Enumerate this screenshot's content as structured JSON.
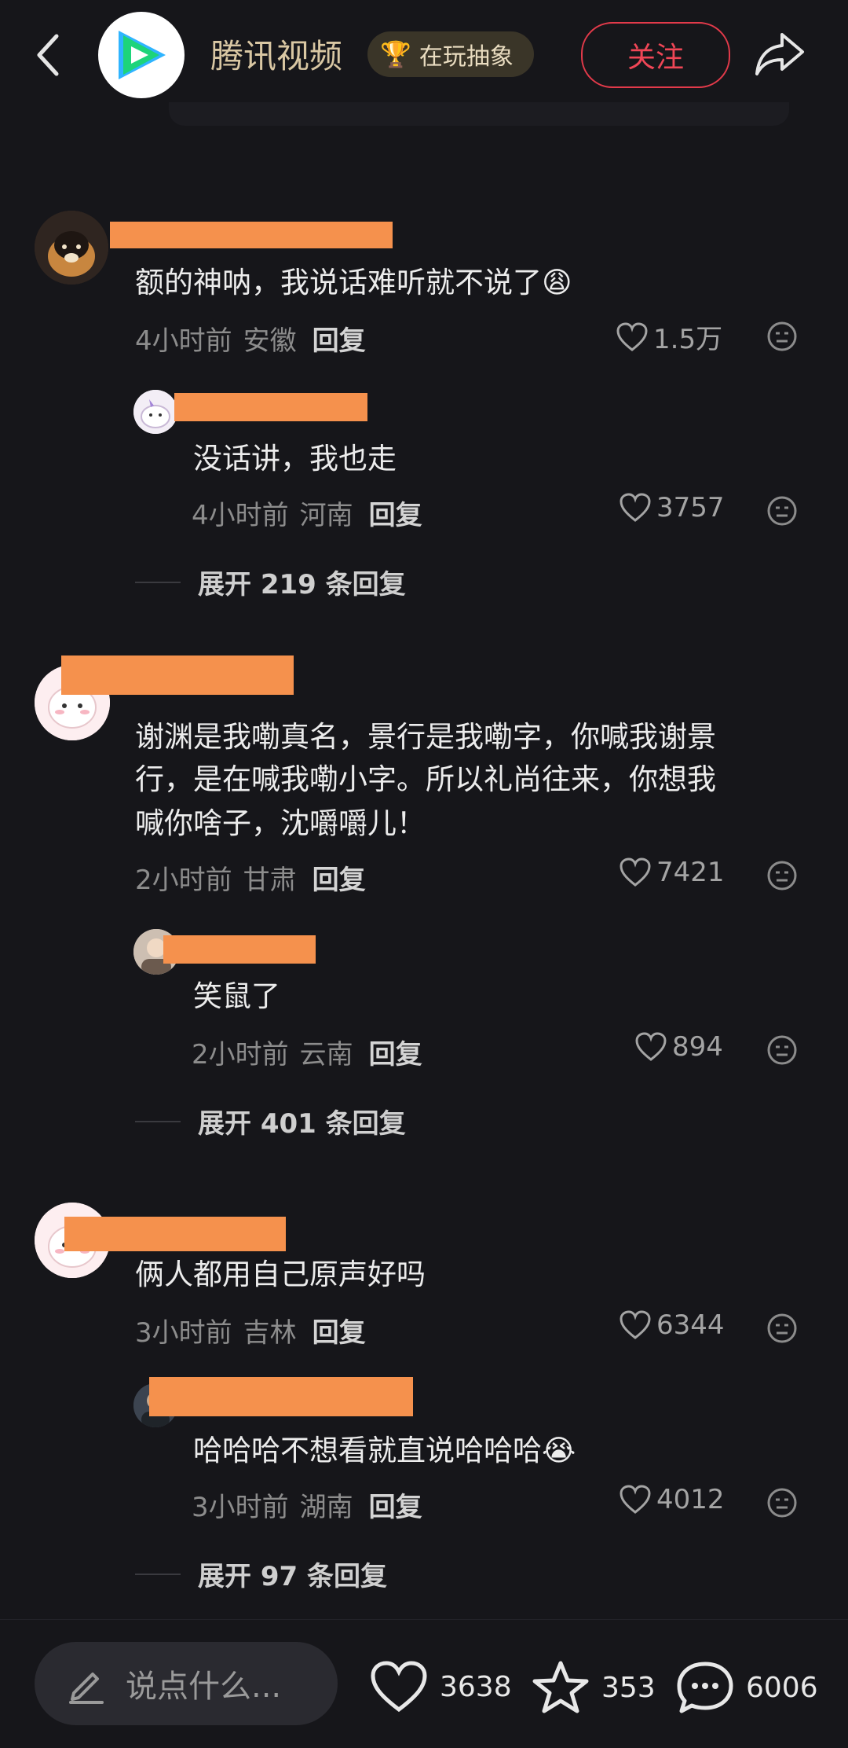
{
  "header": {
    "channel_name": "腾讯视频",
    "badge_label": "在玩抽象",
    "follow_label": "关注"
  },
  "comments": [
    {
      "text": "额的神呐，我说话难听就不说了😩",
      "time": "4小时前",
      "location": "安徽",
      "reply_label": "回复",
      "likes": "1.5万",
      "sub_reply": {
        "text": "没话讲，我也走",
        "time": "4小时前",
        "location": "河南",
        "reply_label": "回复",
        "likes": "3757"
      },
      "expand_label": "展开 219 条回复"
    },
    {
      "text_lines": [
        "谢渊是我嘞真名，景行是我嘞字，你喊我谢景",
        "行，是在喊我嘞小字。所以礼尚往来，你想我",
        "喊你啥子，沈嚼嚼儿！"
      ],
      "time": "2小时前",
      "location": "甘肃",
      "reply_label": "回复",
      "likes": "7421",
      "sub_reply": {
        "text": "笑鼠了",
        "time": "2小时前",
        "location": "云南",
        "reply_label": "回复",
        "likes": "894"
      },
      "expand_label": "展开 401 条回复"
    },
    {
      "text": "俩人都用自己原声好吗",
      "time": "3小时前",
      "location": "吉林",
      "reply_label": "回复",
      "likes": "6344",
      "sub_reply": {
        "text": "哈哈哈不想看就直说哈哈哈😭",
        "time": "3小时前",
        "location": "湖南",
        "reply_label": "回复",
        "likes": "4012"
      },
      "expand_label": "展开 97 条回复"
    }
  ],
  "bottom": {
    "input_placeholder": "说点什么...",
    "like_count": "3638",
    "favorite_count": "353",
    "comment_count": "6006"
  },
  "colors": {
    "background": "#16161a",
    "accent_red": "#e23a4a",
    "mask_orange": "#f5914d",
    "channel_gold": "#d9c7a3"
  }
}
